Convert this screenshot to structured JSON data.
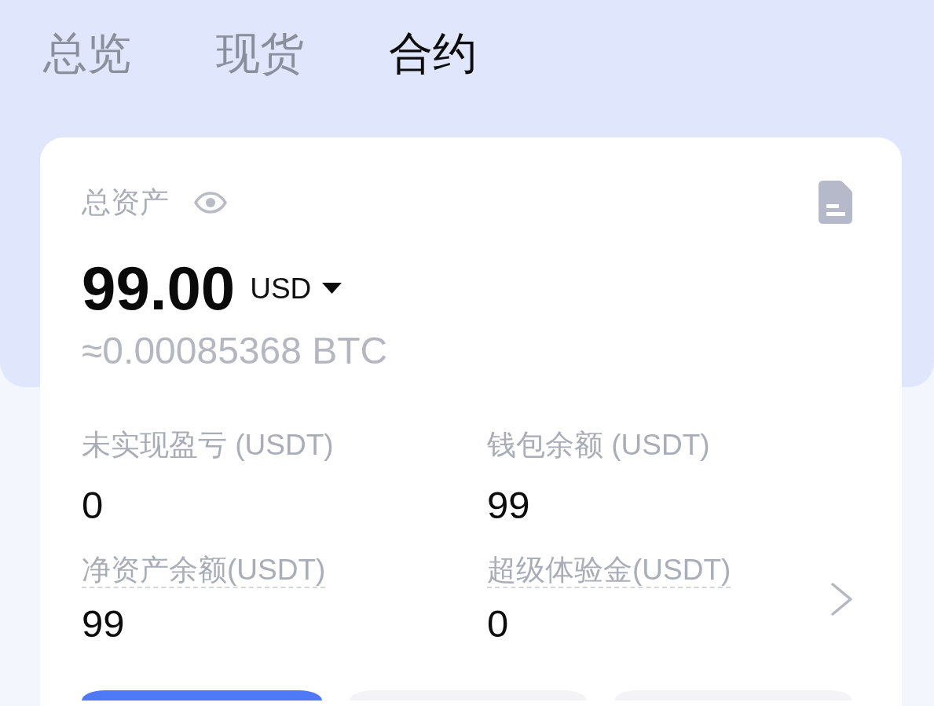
{
  "tabs": [
    {
      "label": "总览",
      "selected": false
    },
    {
      "label": "现货",
      "selected": false
    },
    {
      "label": "合约",
      "selected": true
    }
  ],
  "asset_card": {
    "title": "总资产",
    "amount": "99.00",
    "currency": "USD",
    "btc_equivalent": "≈0.00085368 BTC",
    "metric_rows": [
      {
        "items": [
          {
            "label": "未实现盈亏 (USDT)",
            "value": "0",
            "underlined": false
          },
          {
            "label": "钱包余额 (USDT)",
            "value": "99",
            "underlined": false
          }
        ]
      },
      {
        "items": [
          {
            "label": "净资产余额(USDT)",
            "value": "99",
            "underlined": true
          },
          {
            "label": "超级体验金(USDT)",
            "value": "0",
            "underlined": true
          }
        ]
      }
    ],
    "details_chevron": true,
    "action_buttons": [
      {
        "kind": "primary"
      },
      {
        "kind": "secondary"
      },
      {
        "kind": "secondary"
      }
    ]
  }
}
